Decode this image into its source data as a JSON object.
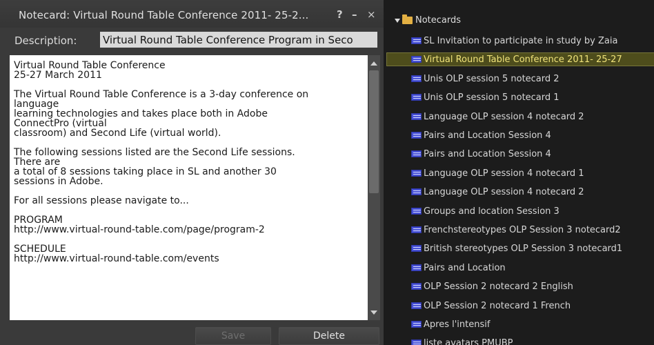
{
  "notecard": {
    "title": "Notecard: Virtual Round Table Conference 2011- 25-2...",
    "help_glyph": "?",
    "minimize_glyph": "–",
    "close_glyph": "×",
    "description_label": "Description:",
    "description_value": "Virtual Round Table Conference Program in Seco",
    "body_text": "Virtual Round Table Conference\n25-27 March 2011\n\nThe Virtual Round Table Conference is a 3-day conference on\nlanguage\nlearning technologies and takes place both in Adobe\nConnectPro (virtual\nclassroom) and Second Life (virtual world).\n\nThe following sessions listed are the Second Life sessions.\nThere are\na total of 8 sessions taking place in SL and another 30\nsessions in Adobe.\n\nFor all sessions please navigate to...\n\nPROGRAM\nhttp://www.virtual-round-table.com/page/program-2\n\nSCHEDULE\nhttp://www.virtual-round-table.com/events",
    "save_label": "Save",
    "delete_label": "Delete"
  },
  "inventory": {
    "root_folder": "Notecards",
    "items": [
      {
        "label": "SL Invitation to participate in study by Zaia",
        "selected": false
      },
      {
        "label": "Virtual Round Table Conference 2011- 25-27",
        "selected": true
      },
      {
        "label": "Unis OLP session 5 notecard 2",
        "selected": false
      },
      {
        "label": "Unis OLP session 5 notecard 1",
        "selected": false
      },
      {
        "label": "Language OLP session 4 notecard 2",
        "selected": false
      },
      {
        "label": "Pairs and Location Session 4",
        "selected": false
      },
      {
        "label": "Pairs and Location Session 4",
        "selected": false
      },
      {
        "label": "Language OLP session 4 notecard 1",
        "selected": false
      },
      {
        "label": "Language OLP session 4 notecard 2",
        "selected": false
      },
      {
        "label": "Groups and location Session 3",
        "selected": false
      },
      {
        "label": "Frenchstereotypes OLP Session 3 notecard2",
        "selected": false
      },
      {
        "label": "British stereotypes OLP Session 3 notecard1",
        "selected": false
      },
      {
        "label": "Pairs and Location",
        "selected": false
      },
      {
        "label": "OLP Session 2 notecard 2 English",
        "selected": false
      },
      {
        "label": "OLP Session 2 notecard 1 French",
        "selected": false
      },
      {
        "label": "Apres l'intensif",
        "selected": false
      },
      {
        "label": "liste avatars PMUBP",
        "selected": false
      }
    ]
  },
  "colors": {
    "selection_bg": "#4e4d1c",
    "selection_text": "#f0e37a",
    "notecard_icon": "#4751d6",
    "folder_icon": "#e3b043"
  }
}
